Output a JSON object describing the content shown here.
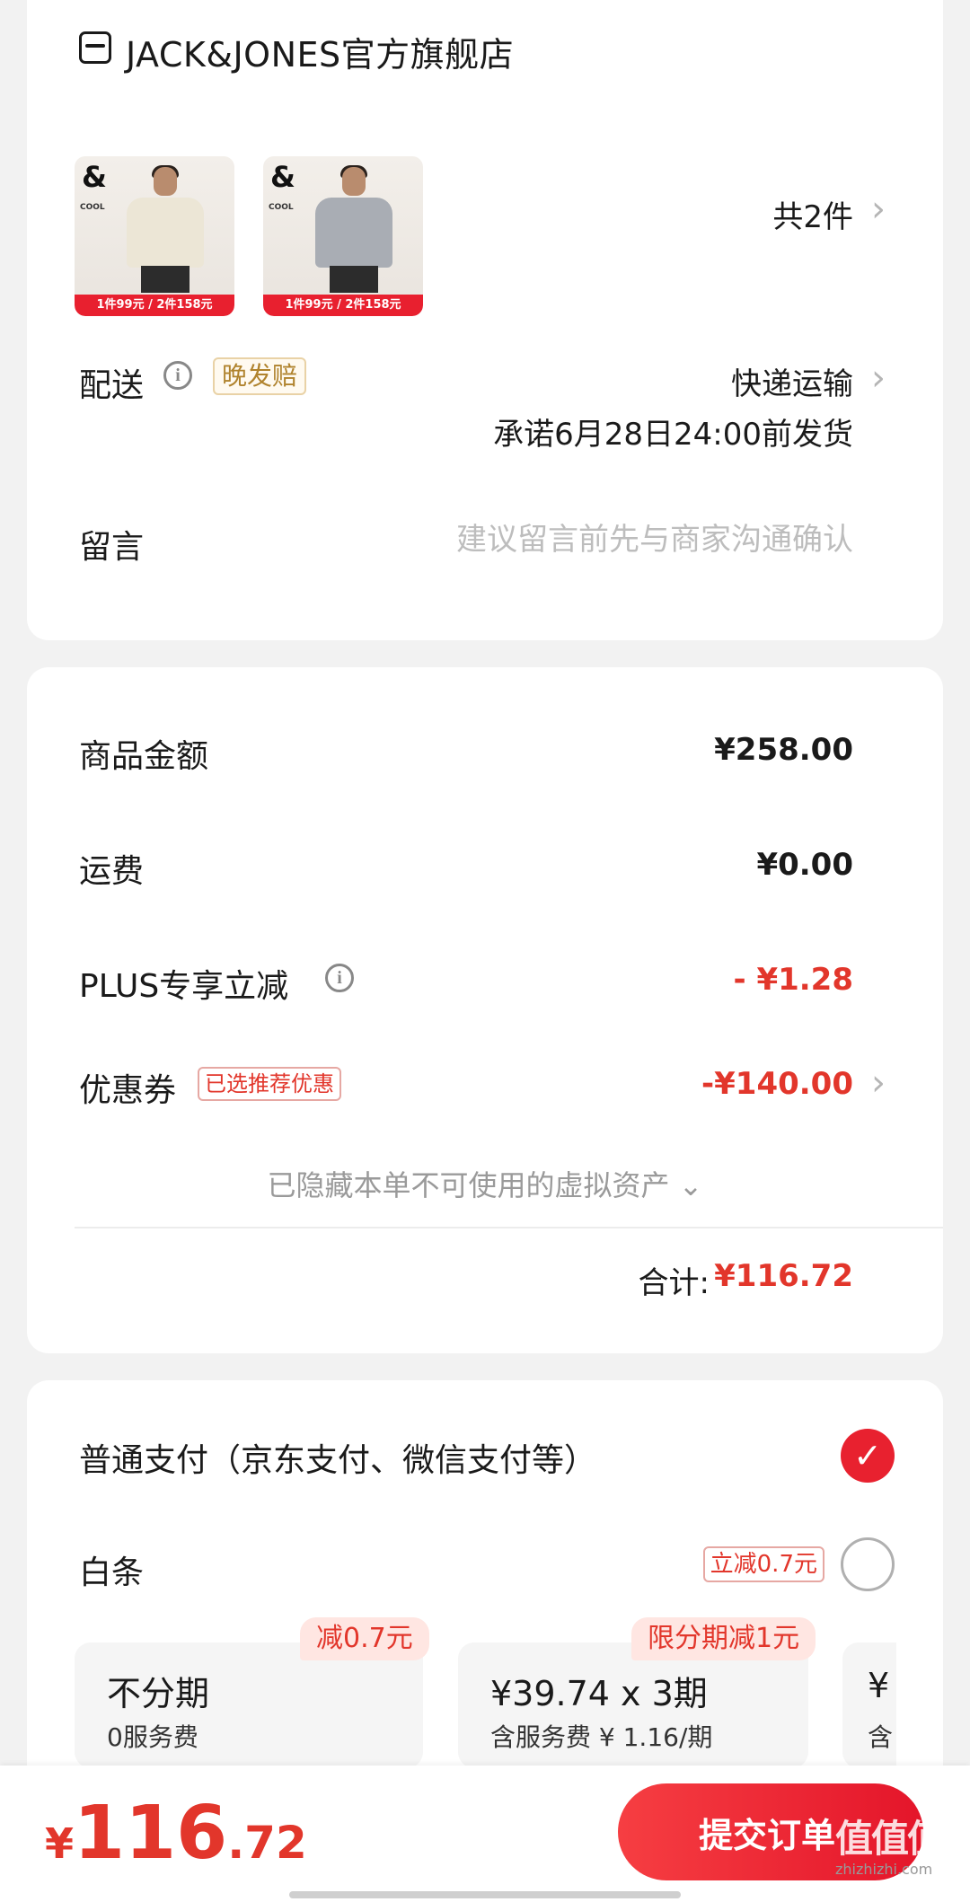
{
  "store": {
    "name": "JACK&JONES官方旗舰店",
    "icon": "store-icon"
  },
  "products": [
    {
      "brand_mark": "&",
      "mark_text": "COOL",
      "banner": "1件99元 / 2件158元",
      "shirt_color": "#ece6d6"
    },
    {
      "brand_mark": "&",
      "mark_text": "COOL",
      "banner": "1件99元 / 2件158元",
      "shirt_color": "#a9adb4"
    }
  ],
  "item_count": "共2件",
  "delivery": {
    "label": "配送",
    "badge": "晚发赔",
    "method": "快递运输",
    "promise": "承诺6月28日24:00前发货"
  },
  "message": {
    "label": "留言",
    "placeholder": "建议留言前先与商家沟通确认"
  },
  "amounts": {
    "goods_label": "商品金额",
    "goods_value": "¥258.00",
    "shipping_label": "运费",
    "shipping_value": "¥0.00",
    "plus_label": "PLUS专享立减",
    "plus_value": "- ¥1.28",
    "coupon_label": "优惠券",
    "coupon_badge": "已选推荐优惠",
    "coupon_value": "-¥140.00",
    "hidden_assets": "已隐藏本单不可使用的虚拟资产 ⌄",
    "total_label": "合计:",
    "total_value": "¥116.72"
  },
  "payment": {
    "normal_label": "普通支付（京东支付、微信支付等）",
    "baitiao_label": "白条",
    "baitiao_badge": "立减0.7元",
    "plans": [
      {
        "tag": "减0.7元",
        "title": "不分期",
        "sub": "0服务费"
      },
      {
        "tag": "限分期减1元",
        "title": "¥39.74 x 3期",
        "sub": "含服务费 ¥ 1.16/期"
      },
      {
        "tag": "",
        "title": "¥",
        "sub": "含"
      }
    ]
  },
  "footer": {
    "currency": "¥",
    "total_int": "116",
    "total_dec": ".72",
    "submit_label": "提交订单",
    "watermark": "值值值",
    "watermark_sub": "zhizhizhi.com"
  },
  "colors": {
    "accent_red": "#e2362b",
    "button_red": "#e4152a",
    "badge_gold": "#b0832d"
  }
}
